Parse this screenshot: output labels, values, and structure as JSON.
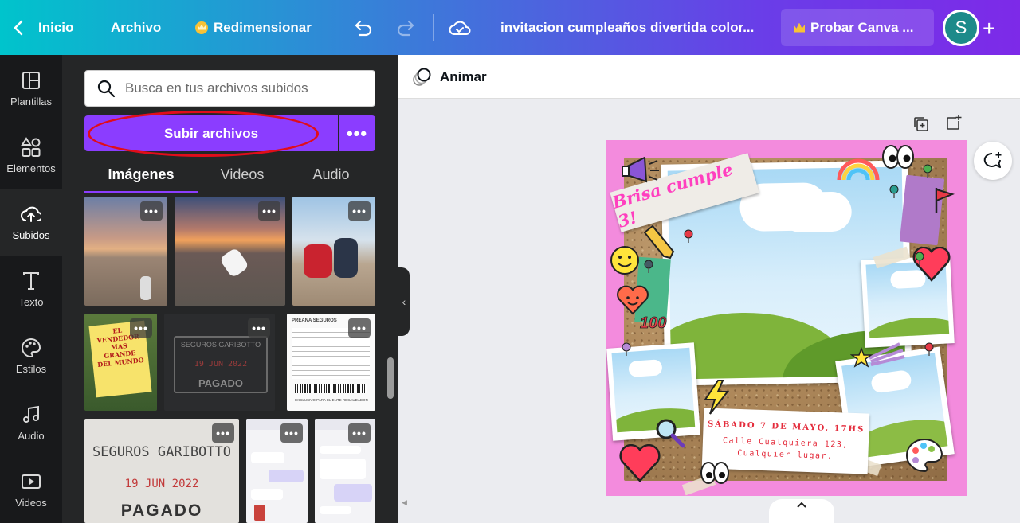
{
  "topbar": {
    "home_label": "Inicio",
    "file_label": "Archivo",
    "resize_label": "Redimensionar",
    "doc_title": "invitacion cumpleaños divertida color...",
    "try_pro_label": "Probar Canva ...",
    "avatar_initial": "S",
    "add_label": "+"
  },
  "rail": {
    "items": [
      {
        "label": "Plantillas",
        "icon": "templates-icon"
      },
      {
        "label": "Elementos",
        "icon": "elements-icon"
      },
      {
        "label": "Subidos",
        "icon": "upload-cloud-icon"
      },
      {
        "label": "Texto",
        "icon": "text-icon"
      },
      {
        "label": "Estilos",
        "icon": "palette-icon"
      },
      {
        "label": "Audio",
        "icon": "music-icon"
      },
      {
        "label": "Videos",
        "icon": "video-icon"
      }
    ],
    "active": "Subidos"
  },
  "panel": {
    "search_placeholder": "Busca en tus archivos subidos",
    "upload_label": "Subir archivos",
    "more_label": "•••",
    "tabs": [
      "Imágenes",
      "Videos",
      "Audio"
    ],
    "active_tab": "Imágenes",
    "thumbnails": {
      "book_text": "EL VENDEDOR MAS GRANDE DEL MUNDO",
      "stamp_name": "SEGUROS GARIBOTTO",
      "stamp_date": "19 JUN 2022",
      "stamp_status": "PAGADO",
      "receipt_brand": "PREANA SEGUROS",
      "receipt_footer": "EXCLUSIVO PARA EL ENTE RECAUDADOR"
    }
  },
  "canvas": {
    "animate_label": "Animar",
    "design": {
      "banner_text": "Brisa cumple 3!",
      "date_text": "SÁBADO 7 DE MAYO, 17HS",
      "address_line1": "Calle Cualquiera 123,",
      "address_line2": "Cualquier lugar."
    }
  },
  "colors": {
    "accent": "#8b3dff",
    "annotation_ring": "#e10d1a",
    "design_bg": "#f38bdd",
    "date_text": "#e42b3b",
    "banner_text": "#ff3fbf"
  }
}
